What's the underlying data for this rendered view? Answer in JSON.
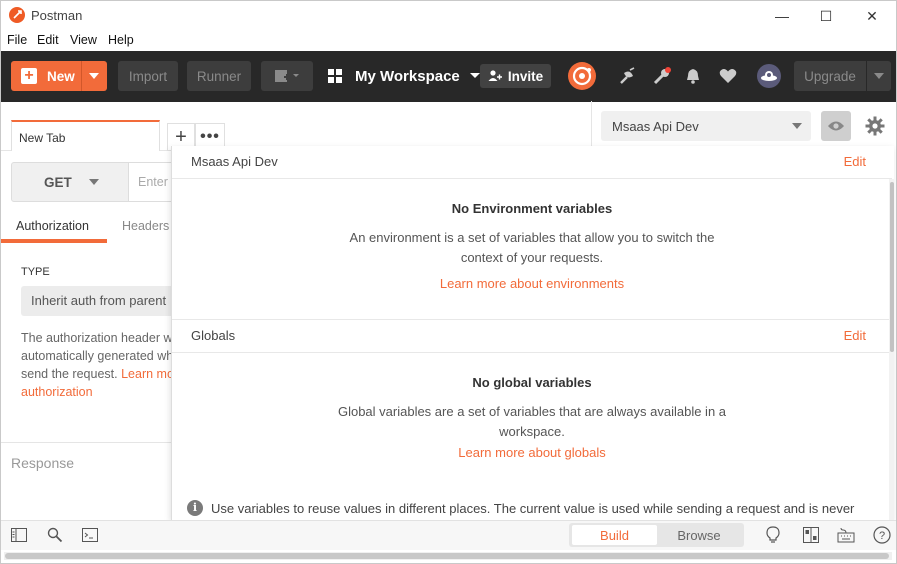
{
  "window": {
    "title": "Postman",
    "minimize": "—",
    "maximize": "☐",
    "close": "✕"
  },
  "menu": [
    "File",
    "Edit",
    "View",
    "Help"
  ],
  "header": {
    "new_label": "New",
    "import_label": "Import",
    "runner_label": "Runner",
    "workspace_label": "My Workspace",
    "invite_label": "Invite",
    "upgrade_label": "Upgrade"
  },
  "request": {
    "tab_label": "New Tab",
    "add_tab": "+",
    "more_tab": "•••",
    "method": "GET",
    "url_placeholder": "Enter",
    "subtabs": [
      "Authorization",
      "Headers"
    ],
    "type_label": "TYPE",
    "auth_type": "Inherit auth from parent",
    "auth_desc_1": "The authorization header w",
    "auth_desc_2": "automatically generated wh",
    "auth_desc_3": "send the request.",
    "auth_link_1": "Learn mo",
    "auth_link_2": "authorization",
    "response_label": "Response"
  },
  "environment": {
    "selected": "Msaas Api Dev"
  },
  "popover": {
    "env_title": "Msaas Api Dev",
    "env_edit": "Edit",
    "env_empty_title": "No Environment variables",
    "env_empty_desc_1": "An environment is a set of variables that allow you to switch the",
    "env_empty_desc_2": "context of your requests.",
    "env_link": "Learn more about environments",
    "globals_title": "Globals",
    "globals_edit": "Edit",
    "globals_empty_title": "No global variables",
    "globals_empty_desc_1": "Global variables are a set of variables that are always available in a",
    "globals_empty_desc_2": "workspace.",
    "globals_link": "Learn more about globals",
    "info_icon": "i",
    "info_text": "Use variables to reuse values in different places. The current value is used while sending a request and is never"
  },
  "statusbar": {
    "build_label": "Build",
    "browse_label": "Browse",
    "help_icon": "?"
  },
  "colors": {
    "accent": "#f26b3a",
    "header_bg": "#282828"
  }
}
